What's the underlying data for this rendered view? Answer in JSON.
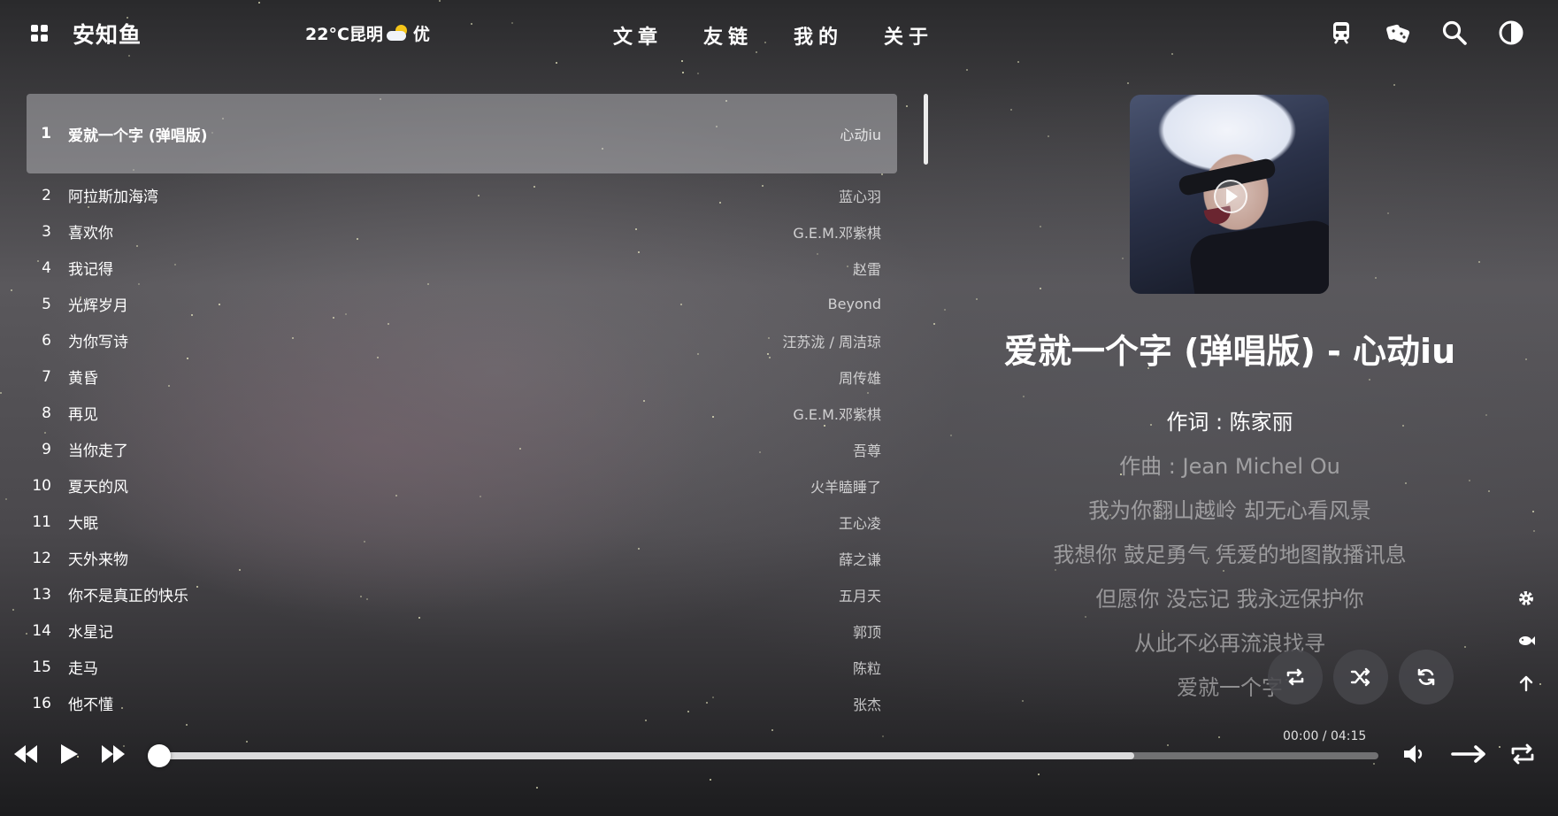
{
  "header": {
    "site_title": "安知鱼",
    "weather": {
      "temp_city": "22°C昆明",
      "quality": "优",
      "icon": "partly-cloudy-icon"
    },
    "nav": [
      {
        "label": "文章"
      },
      {
        "label": "友链"
      },
      {
        "label": "我的"
      },
      {
        "label": "关于"
      }
    ],
    "icons": [
      "subway-icon",
      "dice-icon",
      "search-icon",
      "dark-mode-icon"
    ]
  },
  "playlist": [
    {
      "index": "1",
      "title": "爱就一个字 (弹唱版)",
      "artist": "心动iu",
      "active": true
    },
    {
      "index": "2",
      "title": "阿拉斯加海湾",
      "artist": "蓝心羽"
    },
    {
      "index": "3",
      "title": "喜欢你",
      "artist": "G.E.M.邓紫棋"
    },
    {
      "index": "4",
      "title": "我记得",
      "artist": "赵雷"
    },
    {
      "index": "5",
      "title": "光辉岁月",
      "artist": "Beyond"
    },
    {
      "index": "6",
      "title": "为你写诗",
      "artist": "汪苏泷 / 周洁琼"
    },
    {
      "index": "7",
      "title": "黄昏",
      "artist": "周传雄"
    },
    {
      "index": "8",
      "title": "再见",
      "artist": "G.E.M.邓紫棋"
    },
    {
      "index": "9",
      "title": "当你走了",
      "artist": "吾尊"
    },
    {
      "index": "10",
      "title": "夏天的风",
      "artist": "火羊瞌睡了"
    },
    {
      "index": "11",
      "title": "大眠",
      "artist": "王心凌"
    },
    {
      "index": "12",
      "title": "天外来物",
      "artist": "薛之谦"
    },
    {
      "index": "13",
      "title": "你不是真正的快乐",
      "artist": "五月天"
    },
    {
      "index": "14",
      "title": "水星记",
      "artist": "郭顶"
    },
    {
      "index": "15",
      "title": "走马",
      "artist": "陈粒"
    },
    {
      "index": "16",
      "title": "他不懂",
      "artist": "张杰"
    }
  ],
  "now_playing": {
    "title": "爱就一个字 (弹唱版) - 心动iu",
    "lyrics": [
      {
        "text": "作词 : 陈家丽",
        "state": "current"
      },
      {
        "text": "作曲 : Jean Michel Ou",
        "state": "normal"
      },
      {
        "text": "我为你翻山越岭 却无心看风景",
        "state": "normal"
      },
      {
        "text": "我想你 鼓足勇气 凭爱的地图散播讯息",
        "state": "normal"
      },
      {
        "text": "但愿你 没忘记 我永远保护你",
        "state": "normal"
      },
      {
        "text": "从此不必再流浪找寻",
        "state": "normal"
      },
      {
        "text": "爱就一个字",
        "state": "normal"
      },
      {
        "text": "...",
        "state": "fade"
      }
    ]
  },
  "player": {
    "time": "00:00 / 04:15",
    "progress": 0.0,
    "buffered": 0.8
  },
  "colors": {
    "lyric_dim": "#a9a9ab",
    "round_button_bg": "#46464b"
  }
}
